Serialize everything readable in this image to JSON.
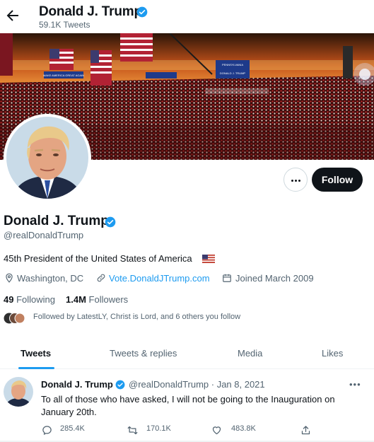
{
  "header": {
    "name": "Donald J. Trump",
    "tweet_count": "59.1K Tweets"
  },
  "banner": {
    "sign_text_1": "MAKE AMERICA GREAT AGAIN",
    "sign_text_2": "PENNSYLVANIA",
    "sign_text_3": "DONALD J. TRUMP"
  },
  "profile": {
    "name": "Donald J. Trump",
    "handle": "@realDonaldTrump",
    "bio": "45th President of the United States of America",
    "location": "Washington, DC",
    "website": "Vote.DonaldJTrump.com",
    "joined": "Joined March 2009",
    "following_count": "49",
    "following_label": "Following",
    "followers_count": "1.4M",
    "followers_label": "Followers",
    "followed_by": "Followed by LatestLY, Christ is Lord, and 6 others you follow"
  },
  "actions": {
    "follow_label": "Follow"
  },
  "tabs": [
    {
      "label": "Tweets",
      "active": true
    },
    {
      "label": "Tweets & replies",
      "active": false
    },
    {
      "label": "Media",
      "active": false
    },
    {
      "label": "Likes",
      "active": false
    }
  ],
  "tweet": {
    "name": "Donald J. Trump",
    "handle_date": "@realDonaldTrump · Jan 8, 2021",
    "text": "To all of those who have asked, I will not be going to the Inauguration on January 20th.",
    "replies": "285.4K",
    "retweets": "170.1K",
    "likes": "483.8K"
  },
  "colors": {
    "accent": "#1d9bf0",
    "text": "#0f1419",
    "muted": "#536471",
    "follow_button": "#0f1419"
  },
  "icons": [
    "back-arrow-icon",
    "verified-badge-icon",
    "more-icon",
    "location-icon",
    "link-icon",
    "calendar-icon",
    "reply-icon",
    "retweet-icon",
    "like-icon",
    "share-icon"
  ]
}
